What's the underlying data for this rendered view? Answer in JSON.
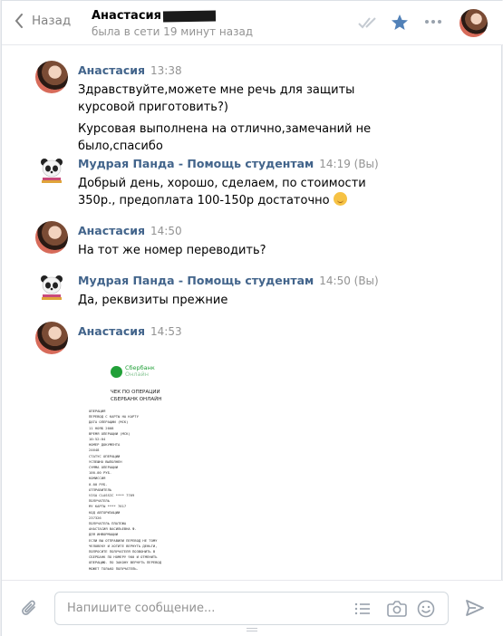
{
  "header": {
    "back_label": "Назад",
    "peer_name": "Анастасия",
    "peer_status": "была в сети 19 минут назад"
  },
  "messages": [
    {
      "author": "Анастасия",
      "time": "13:38",
      "text_1": "Здравствуйте,можете мне речь для защиты курсовой приготовить?)",
      "text_2": "Курсовая выполнена на отлично,замечаний не было,спасибо"
    },
    {
      "author": "Мудрая Панда - Помощь студентам",
      "time": "14:19 (Вы)",
      "text": "Добрый день, хорошо, сделаем, по стоимости 350р., предоплата 100-150р достаточно"
    },
    {
      "author": "Анастасия",
      "time": "14:50",
      "text": "На тот же номер переводить?"
    },
    {
      "author": "Мудрая Панда - Помощь студентам",
      "time": "14:50 (Вы)",
      "text": "Да, реквизиты прежние"
    },
    {
      "author": "Анастасия",
      "time": "14:53",
      "attachment": {
        "bank_name": "Сбербанк",
        "bank_sub": "Онлайн",
        "title_1": "ЧЕК ПО ОПЕРАЦИИ",
        "title_2": "СБЕРБАНК ОНЛАЙН",
        "body": "ОПЕРАЦИЯ\nПЕРЕВОД С КАРТЫ НА КАРТУ\nДАТА ОПЕРАЦИИ (МСК)\n11 НОЯБ 2008\nВРЕМЯ ОПЕРАЦИИ (МСК)\n10:52:04\nНОМЕР ДОКУМЕНТА\n24648\nСТАТУС ОПЕРАЦИИ\nУСПЕШНО ВЫПОЛНЕН\nСУММА ОПЕРАЦИИ\n100.00 РУБ.\nКОМИССИЯ\n0.00 РУБ.\nОТПРАВИТЕЛЬ\nVISA CLASSIC **** 7769\nПОЛУЧАТЕЛЬ\nMY КАРТЫ **** 7617\nКОД АВТОРИЗАЦИИ\n237326\nПОЛУЧАТЕЛЬ ПЛАТЕЖА\nАНАСТАСИЯ ВАСИЛЬЕВНА Ф.\nДЛЯ ИНФОРМАЦИИ\nЕСЛИ ВЫ ОТПРАВИЛИ ПЕРЕВОД НЕ ТОМУ\nЧЕЛОВЕКУ И ХОТИТЕ ВЕРНУТЬ ДЕНЬГИ,\nПОПРОСИТЕ ПОЛУЧАТЕЛЯ ПОЗВОНИТЬ В\nСБЕРБАНК ПО НОМЕРУ 900 И ОТМЕНИТЬ\nОПЕРАЦИЮ. ПО ЗАКОНУ ВЕРНУТЬ ПЕРЕВОД\nМОЖЕТ ТОЛЬКО ПОЛУЧАТЕЛЬ."
      }
    }
  ],
  "composer": {
    "placeholder": "Напишите сообщение..."
  },
  "colors": {
    "accent": "#5181b8",
    "author": "#42648b",
    "muted": "#939393",
    "star": "#5181b8",
    "sber": "#21a038"
  },
  "icons": [
    "back-chevron-icon",
    "read-checks-icon",
    "star-icon",
    "more-icon",
    "paperclip-icon",
    "template-list-icon",
    "camera-icon",
    "emoji-icon",
    "send-icon"
  ]
}
